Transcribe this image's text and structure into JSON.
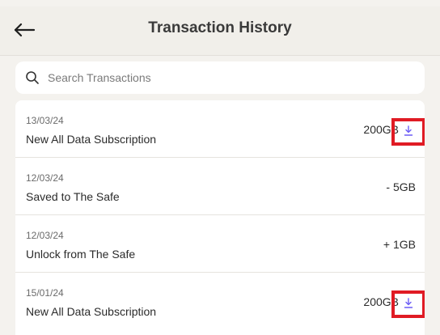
{
  "header": {
    "title": "Transaction History"
  },
  "search": {
    "placeholder": "Search Transactions"
  },
  "transactions": [
    {
      "date": "13/03/24",
      "description": "New All Data Subscription",
      "amount": "200GB",
      "has_download": true
    },
    {
      "date": "12/03/24",
      "description": "Saved to The Safe",
      "amount": "- 5GB",
      "has_download": false
    },
    {
      "date": "12/03/24",
      "description": "Unlock from The Safe",
      "amount": "+ 1GB",
      "has_download": false
    },
    {
      "date": "15/01/24",
      "description": "New All Data Subscription",
      "amount": "200GB",
      "has_download": true
    }
  ],
  "colors": {
    "highlight_border": "#e01b24",
    "download_icon": "#6b5cf6"
  }
}
